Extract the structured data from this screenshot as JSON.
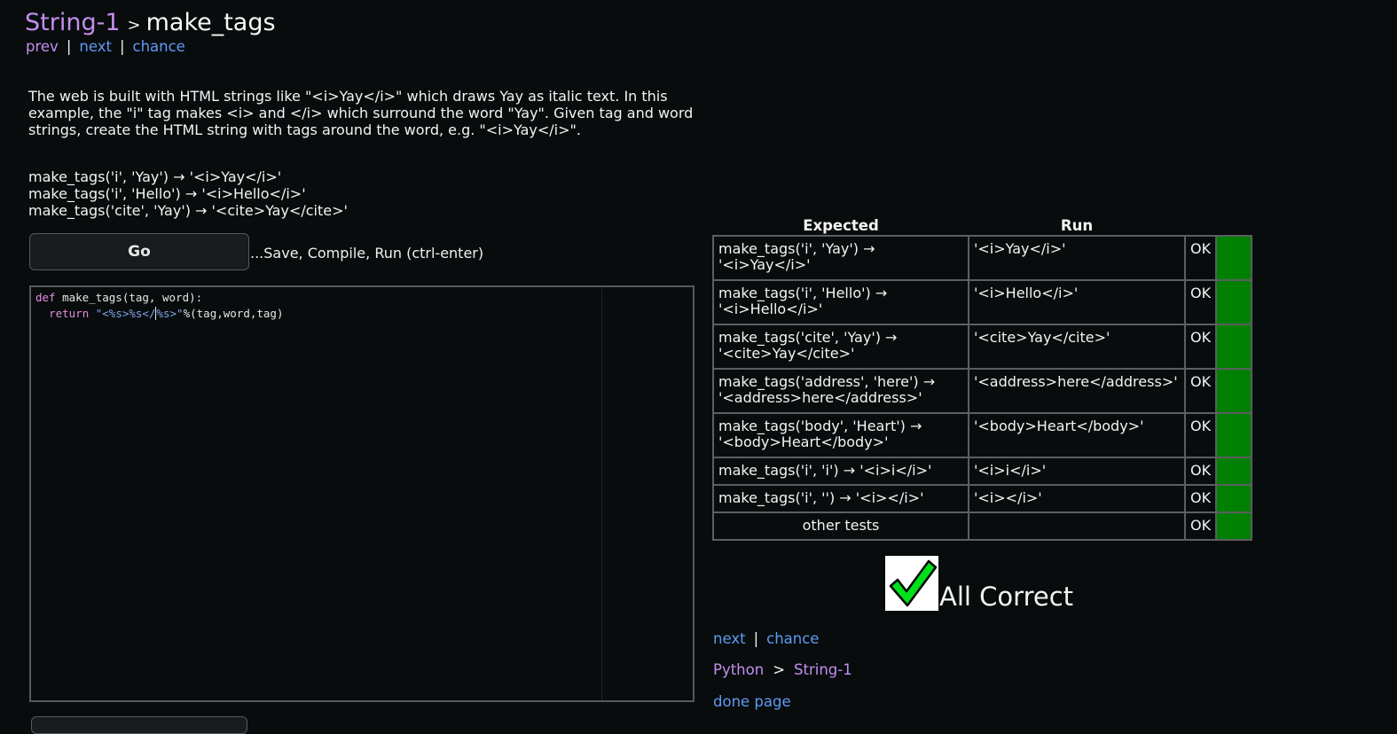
{
  "header": {
    "section": "String-1",
    "separator": ">",
    "title": "make_tags"
  },
  "top_nav": {
    "prev": "prev",
    "next": "next",
    "chance": "chance",
    "sep": "|"
  },
  "description": "The web is built with HTML strings like \"<i>Yay</i>\" which draws Yay as italic text. In this example, the \"i\" tag makes <i> and </i> which surround the word \"Yay\". Given tag and word strings, create the HTML string with tags around the word, e.g. \"<i>Yay</i>\".",
  "examples": [
    "make_tags('i', 'Yay') → '<i>Yay</i>'",
    "make_tags('i', 'Hello') → '<i>Hello</i>'",
    "make_tags('cite', 'Yay') → '<cite>Yay</cite>'"
  ],
  "go_button": {
    "label": "Go",
    "hint": "...Save, Compile, Run (ctrl-enter)"
  },
  "code": {
    "line1_kw": "def",
    "line1_rest": " make_tags(tag, word):",
    "line2_indent": "  ",
    "line2_kw": "return",
    "line2_str_a": "\"<%s>%s</",
    "line2_str_b": "%s>\"",
    "line2_rest": "%(tag,word,tag)"
  },
  "results": {
    "headers": {
      "expected": "Expected",
      "run": "Run"
    },
    "rows": [
      {
        "expected_a": "make_tags('i', 'Yay') →",
        "expected_b": "'<i>Yay</i>'",
        "run": "'<i>Yay</i>'",
        "status": "OK"
      },
      {
        "expected_a": "make_tags('i', 'Hello') →",
        "expected_b": "'<i>Hello</i>'",
        "run": "'<i>Hello</i>'",
        "status": "OK"
      },
      {
        "expected_a": "make_tags('cite', 'Yay') →",
        "expected_b": "'<cite>Yay</cite>'",
        "run": "'<cite>Yay</cite>'",
        "status": "OK"
      },
      {
        "expected_a": "make_tags('address', 'here') →",
        "expected_b": "'<address>here</address>'",
        "run": "'<address>here</address>'",
        "status": "OK"
      },
      {
        "expected_a": "make_tags('body', 'Heart') →",
        "expected_b": "'<body>Heart</body>'",
        "run": "'<body>Heart</body>'",
        "status": "OK"
      },
      {
        "expected": "make_tags('i', 'i') → '<i>i</i>'",
        "run": "'<i>i</i>'",
        "status": "OK"
      },
      {
        "expected": "make_tags('i', '') → '<i></i>'",
        "run": "'<i></i>'",
        "status": "OK"
      },
      {
        "expected": "other tests",
        "run": "",
        "status": "OK"
      }
    ],
    "pass_color": "#008000"
  },
  "summary": {
    "icon": "checkmark-icon",
    "text": "All Correct"
  },
  "bottom_nav": {
    "next": "next",
    "chance": "chance",
    "sep": "|"
  },
  "bottom_crumb": {
    "root": "Python",
    "sep": ">",
    "section": "String-1"
  },
  "done_page": "done page"
}
